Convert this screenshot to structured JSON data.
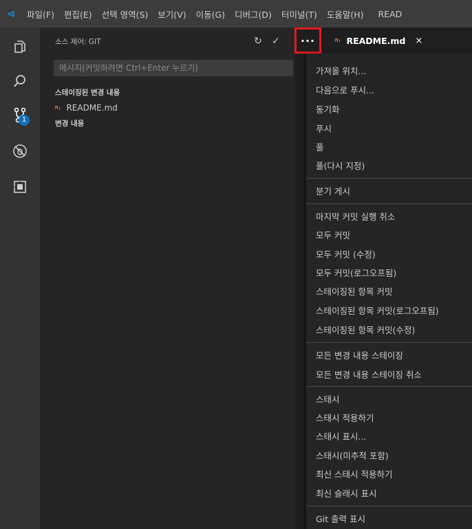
{
  "menubar": {
    "logo": "⊲",
    "items": [
      "파일(F)",
      "편집(E)",
      "선택 영역(S)",
      "보기(V)",
      "이동(G)",
      "디버그(D)",
      "터미널(T)",
      "도움말(H)"
    ],
    "window_title": "READ"
  },
  "activity_bar": {
    "icons": [
      "explorer-icon",
      "search-icon",
      "source-control-icon",
      "debug-icon",
      "extensions-icon"
    ],
    "source_control_badge": "1"
  },
  "sidebar": {
    "title": "소스 제어: GIT",
    "refresh_icon": "↻",
    "commit_icon": "✓",
    "message_placeholder": "메시지(커밋하려면 Ctrl+Enter 누르기)",
    "staged_header": "스테이징된 변경 내용",
    "staged_files": [
      {
        "icon": "M↓",
        "name": "README.md"
      }
    ],
    "changes_header": "변경 내용"
  },
  "more_button": {
    "label": "···"
  },
  "tab": {
    "icon": "M↓",
    "label": "README.md",
    "close": "×"
  },
  "menu": {
    "groups": [
      [
        "가져올 위치...",
        "다음으로 푸시...",
        "동기화",
        "푸시",
        "풀",
        "풀(다시 지정)"
      ],
      [
        "분기 게시"
      ],
      [
        "마지막 커밋 실행 취소",
        "모두 커밋",
        "모두 커밋 (수정)",
        "모두 커밋(로그오프됨)",
        "스테이징된 항목 커밋",
        "스테이징된 항목 커밋(로그오프됨)",
        "스테이징된 항목 커밋(수정)"
      ],
      [
        "모든 변경 내용 스테이징",
        "모든 변경 내용 스테이징 취소"
      ],
      [
        "스태시",
        "스태시 적용하기",
        "스태시 표시...",
        "스태시(미추적 포함)",
        "최신 스태시 적용하기",
        "최신 슬래시 표시"
      ],
      [
        "Git 출력 표시"
      ]
    ]
  }
}
